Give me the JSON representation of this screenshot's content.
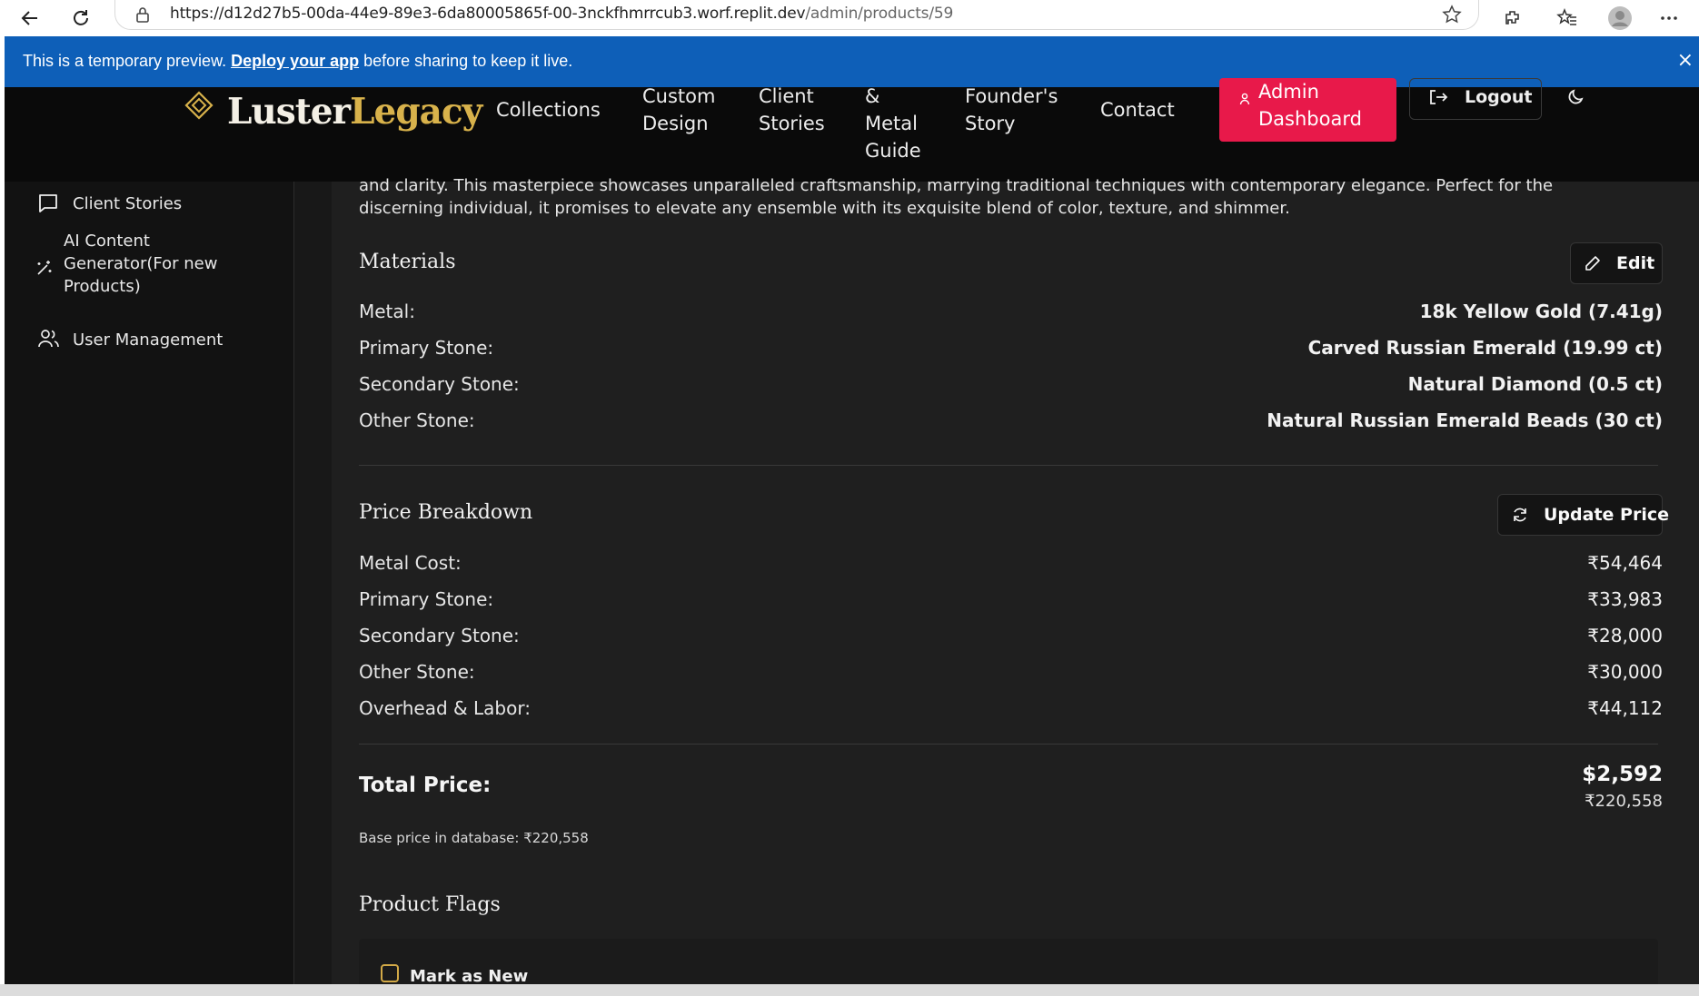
{
  "browser": {
    "url_host": "https://d12d27b5-00da-44e9-89e3-6da80005865f-00-3nckfhmrrcub3.worf.replit.dev",
    "url_path": "/admin/products/59"
  },
  "banner": {
    "text_before": "This is a temporary preview. ",
    "link": "Deploy your app",
    "text_after": " before sharing to keep it live.",
    "close": "×"
  },
  "header": {
    "logo_part1": "Luster",
    "logo_part2": "Legacy",
    "nav": {
      "collections": "Collections",
      "custom_design_1": "Custom",
      "custom_design_2": "Design",
      "client_stories_1": "Client",
      "client_stories_2": "Stories",
      "metal_guide_1": "&",
      "metal_guide_2": "Metal",
      "metal_guide_3": "Guide",
      "founders_1": "Founder's",
      "founders_2": "Story",
      "contact": "Contact"
    },
    "admin_1": "Admin",
    "admin_2": "Dashboard",
    "logout": "Logout"
  },
  "sidebar": {
    "client_stories": "Client Stories",
    "ai_1": "AI Content",
    "ai_2": "Generator(For new",
    "ai_3": "Products)",
    "user_management": "User Management"
  },
  "main": {
    "description_1": "and clarity. This masterpiece showcases unparalleled craftsmanship, marrying traditional techniques with contemporary elegance. Perfect for the",
    "description_2": "discerning individual, it promises to elevate any ensemble with its exquisite blend of color, texture, and shimmer.",
    "materials": {
      "title": "Materials",
      "edit": "Edit",
      "rows": [
        {
          "label": "Metal:",
          "value": "18k Yellow Gold (7.41g)"
        },
        {
          "label": "Primary Stone:",
          "value": "Carved Russian Emerald (19.99 ct)"
        },
        {
          "label": "Secondary Stone:",
          "value": "Natural Diamond (0.5 ct)"
        },
        {
          "label": "Other Stone:",
          "value": "Natural Russian Emerald Beads (30 ct)"
        }
      ]
    },
    "price": {
      "title": "Price Breakdown",
      "update": "Update Price",
      "rows": [
        {
          "label": "Metal Cost:",
          "value": "₹54,464"
        },
        {
          "label": "Primary Stone:",
          "value": "₹33,983"
        },
        {
          "label": "Secondary Stone:",
          "value": "₹28,000"
        },
        {
          "label": "Other Stone:",
          "value": "₹30,000"
        },
        {
          "label": "Overhead & Labor:",
          "value": "₹44,112"
        }
      ],
      "total_label": "Total Price:",
      "total_usd": "$2,592",
      "total_inr": "₹220,558",
      "base_note": "Base price in database: ₹220,558"
    },
    "flags": {
      "title": "Product Flags",
      "mark_new": "Mark as New"
    }
  },
  "colors": {
    "accent_gold": "#d8b24b",
    "admin_red": "#e8194a",
    "banner_blue": "#0e5fb8"
  }
}
